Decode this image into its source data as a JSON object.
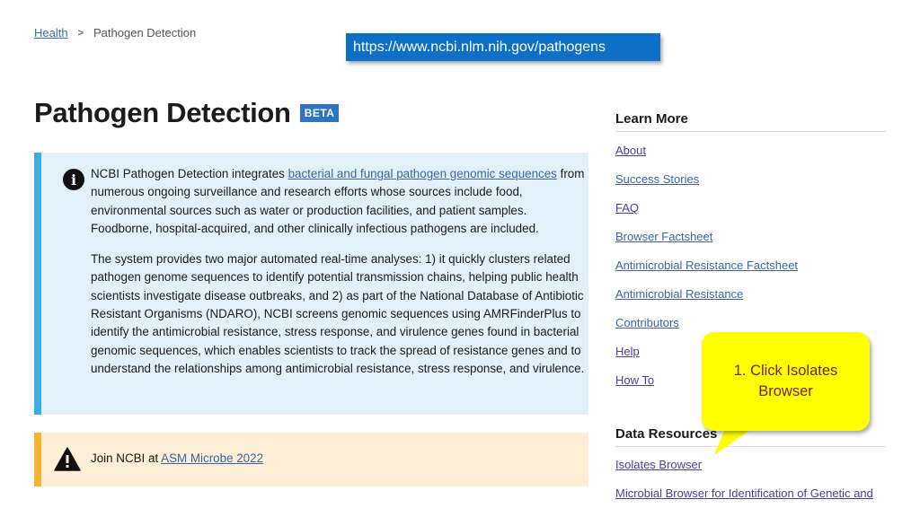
{
  "breadcrumb": {
    "parent": "Health",
    "separator": ">",
    "current": "Pathogen Detection"
  },
  "url_banner": "https://www.ncbi.nlm.nih.gov/pathogens",
  "page": {
    "title": "Pathogen Detection",
    "badge": "BETA"
  },
  "info_box": {
    "icon": "info-icon",
    "p1_before_link": "NCBI Pathogen Detection integrates ",
    "p1_link": "bacterial and fungal pathogen genomic sequences",
    "p1_after_link": " from numerous ongoing surveillance and research efforts whose sources include food, environmental sources such as water or production facilities, and patient samples. Foodborne, hospital-acquired, and other clinically infectious pathogens are included.",
    "p2": "The system provides two major automated real-time analyses: 1) it quickly clusters related pathogen genome sequences to identify potential transmission chains, helping public health scientists investigate disease outbreaks, and 2) as part of the National Database of Antibiotic Resistant Organisms (NDARO), NCBI screens genomic sequences using AMRFinderPlus to identify the antimicrobial resistance, stress response, and virulence genes found in bacterial genomic sequences, which enables scientists to track the spread of resistance genes and to understand the relationships among antimicrobial resistance, stress response, and virulence."
  },
  "warning_box": {
    "icon": "warning-icon",
    "text": "Join NCBI at ",
    "link": "ASM Microbe 2022"
  },
  "sidebar": {
    "learn_more": {
      "heading": "Learn More",
      "links": [
        "About",
        "Success Stories",
        "FAQ",
        "Browser Factsheet",
        "Antimicrobial Resistance Factsheet",
        "Antimicrobial Resistance",
        "Contributors",
        "Help",
        "How To"
      ]
    },
    "data_resources": {
      "heading": "Data Resources",
      "links": [
        "Isolates Browser",
        "Microbial Browser for Identification of Genetic and"
      ]
    }
  },
  "callout": {
    "text": "1. Click Isolates Browser"
  },
  "colors": {
    "link": "#3a64a8",
    "visited_link": "#4a3fa0",
    "url_banner": "#0e6fc7",
    "info_bg": "#e2f1f9",
    "info_border": "#3fb0e0",
    "warn_bg": "#fcefd5",
    "warn_border": "#f3b532",
    "callout_bg": "#ffff00",
    "callout_text": "#7a1e12"
  }
}
